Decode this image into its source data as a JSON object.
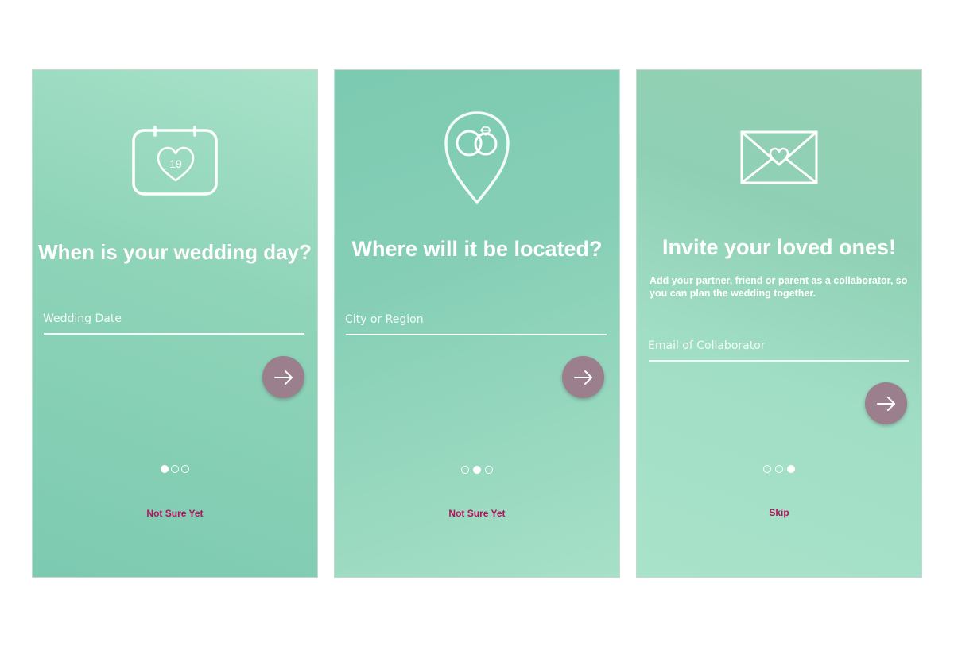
{
  "colors": {
    "accent_button": "#9b7f8d",
    "link": "#b3125d",
    "text": "#ffffff",
    "teal_dark": "#7ccab1",
    "teal_light": "#a8e2c9"
  },
  "screens": [
    {
      "icon": "calendar-heart-icon",
      "calendar_day": "19",
      "title": "When is your wedding day?",
      "input_placeholder": "Wedding Date",
      "input_value": "",
      "next_icon": "arrow-right-icon",
      "pagination": {
        "total": 3,
        "active": 1
      },
      "link_label": "Not Sure Yet"
    },
    {
      "icon": "location-pin-rings-icon",
      "title": "Where will it be located?",
      "input_placeholder": "City or Region",
      "input_value": "",
      "next_icon": "arrow-right-icon",
      "pagination": {
        "total": 3,
        "active": 2
      },
      "link_label": "Not Sure Yet"
    },
    {
      "icon": "envelope-heart-icon",
      "title": "Invite your loved ones!",
      "subtitle": "Add your partner, friend or parent as a collaborator, so you can plan the wedding together.",
      "input_placeholder": "Email of Collaborator",
      "input_value": "",
      "next_icon": "arrow-right-icon",
      "pagination": {
        "total": 3,
        "active": 3
      },
      "link_label": "Skip"
    }
  ]
}
